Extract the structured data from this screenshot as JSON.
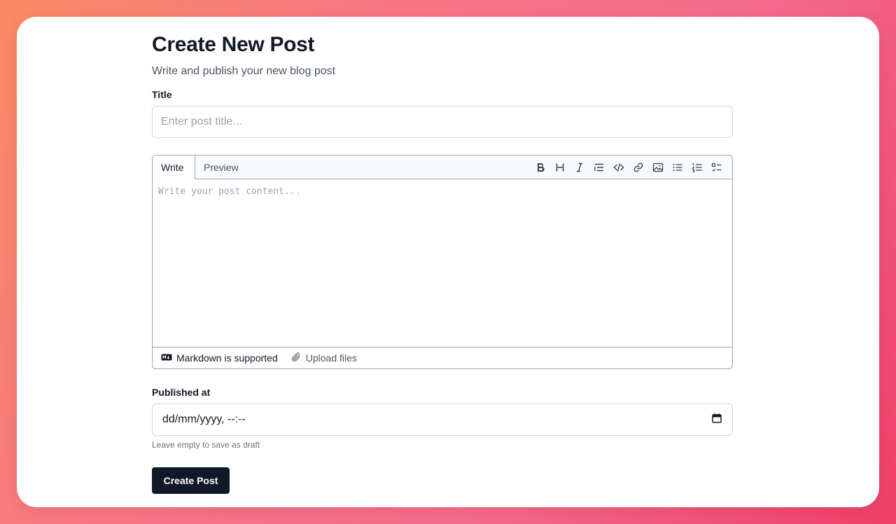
{
  "page": {
    "title": "Create New Post",
    "subtitle": "Write and publish your new blog post"
  },
  "title_field": {
    "label": "Title",
    "placeholder": "Enter post title...",
    "value": ""
  },
  "editor": {
    "tabs": [
      {
        "label": "Write",
        "active": true
      },
      {
        "label": "Preview",
        "active": false
      }
    ],
    "toolbar": [
      "bold-icon",
      "heading-icon",
      "italic-icon",
      "quote-icon",
      "code-icon",
      "link-icon",
      "image-icon",
      "bullet-list-icon",
      "numbered-list-icon",
      "task-list-icon"
    ],
    "placeholder": "Write your post content...",
    "footer": {
      "markdown_label": "Markdown is supported",
      "upload_label": "Upload files"
    }
  },
  "published_field": {
    "label": "Published at",
    "value": "dd/mm/yyyy, --:--",
    "hint": "Leave empty to save as draft"
  },
  "submit": {
    "label": "Create Post"
  },
  "colors": {
    "primary_button": "#111827",
    "border": "#d1d5db",
    "background_gradient_start": "#fb8a64",
    "background_gradient_end": "#ef3f6a"
  }
}
